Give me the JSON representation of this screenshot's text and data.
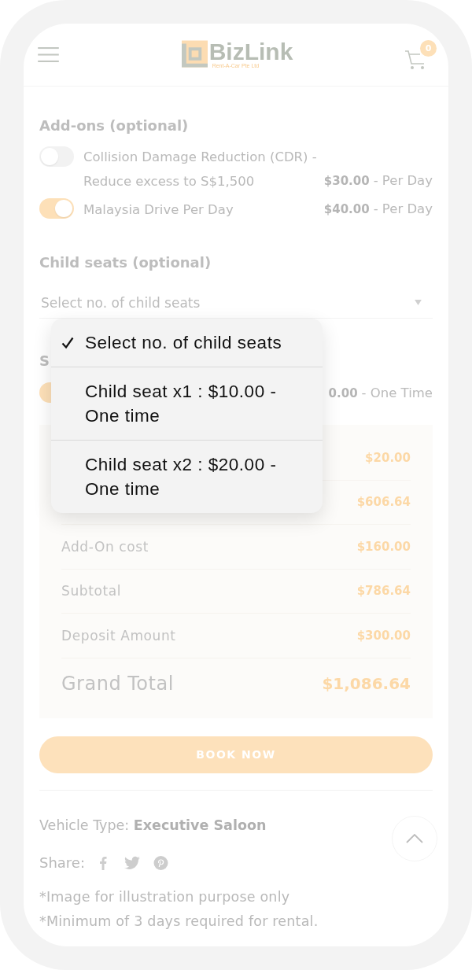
{
  "header": {
    "logo": {
      "name": "BizLink",
      "tagline": "Rent-A-Car Pte Ltd"
    },
    "cart_count": "0"
  },
  "addons": {
    "title": "Add-ons (optional)",
    "items": [
      {
        "name": "Collision Damage Reduction (CDR) - Reduce excess to S$1,500",
        "price": "$30.00",
        "unit": "- Per Day",
        "on": false
      },
      {
        "name": "Malaysia Drive Per Day",
        "price": "$40.00",
        "unit": "- Per Day",
        "on": true
      }
    ]
  },
  "child_seats": {
    "title": "Child seats (optional)",
    "select": {
      "value": "Select no. of child seats"
    }
  },
  "section_3": {
    "title": "S",
    "items": [
      {
        "price": "0.00",
        "unit": "- One Time",
        "on": true
      }
    ]
  },
  "summary": {
    "rows": [
      {
        "kind": "line",
        "value": "$20.00"
      },
      {
        "kind": "line",
        "value": "$606.64"
      },
      {
        "kind": "line",
        "label": "Add-On cost",
        "value": "$160.00"
      },
      {
        "kind": "line",
        "label": "Subtotal",
        "value": "$786.64"
      },
      {
        "kind": "line",
        "label": "Deposit Amount",
        "value": "$300.00"
      },
      {
        "kind": "total",
        "label": "Grand Total",
        "value": "$1,086.64"
      }
    ]
  },
  "book_button": "BOOK NOW",
  "vehicle_type": "Vehicle Type: **Executive Saloon**",
  "share": {
    "label": "Share:"
  },
  "notes": [
    "*Image for illustration purpose only",
    "*Minimum of 3 days required for rental."
  ],
  "dropdown": {
    "options": [
      {
        "label": "Select no. of child seats",
        "selected": true
      },
      {
        "label": "Child seat x1 : $10.00 - One time",
        "selected": false
      },
      {
        "label": "Child seat x2 : $20.00 - One time",
        "selected": false
      }
    ]
  }
}
